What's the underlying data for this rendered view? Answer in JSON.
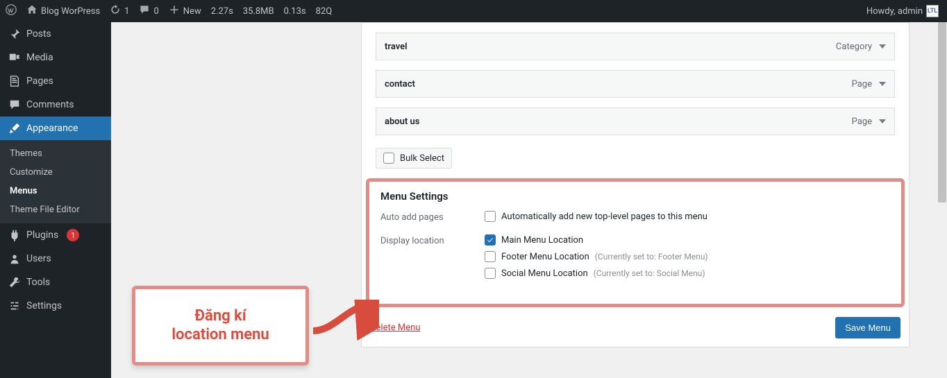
{
  "adminbar": {
    "site_title": "Blog WorPress",
    "updates": "1",
    "comments": "0",
    "new_label": "New",
    "stats": [
      "2.27s",
      "35.8MB",
      "0.13s",
      "82Q"
    ],
    "howdy": "Howdy, admin",
    "user_badge": "LTL"
  },
  "sidebar": {
    "items": [
      {
        "icon": "pin",
        "label": "Posts"
      },
      {
        "icon": "media",
        "label": "Media"
      },
      {
        "icon": "page",
        "label": "Pages"
      },
      {
        "icon": "comments",
        "label": "Comments"
      }
    ],
    "appearance_label": "Appearance",
    "appearance_sub": [
      {
        "label": "Themes"
      },
      {
        "label": "Customize"
      },
      {
        "label": "Menus",
        "current": true
      },
      {
        "label": "Theme File Editor"
      }
    ],
    "lower": [
      {
        "icon": "plugin",
        "label": "Plugins",
        "badge": "1"
      },
      {
        "icon": "users",
        "label": "Users"
      },
      {
        "icon": "tools",
        "label": "Tools"
      },
      {
        "icon": "settings",
        "label": "Settings"
      }
    ]
  },
  "menu_structure": {
    "items": [
      {
        "label": "travel",
        "type": "Category"
      },
      {
        "label": "contact",
        "type": "Page"
      },
      {
        "label": "about us",
        "type": "Page"
      }
    ],
    "bulk_label": "Bulk Select"
  },
  "menu_settings": {
    "heading": "Menu Settings",
    "auto_label": "Auto add pages",
    "auto_option": "Automatically add new top-level pages to this menu",
    "display_label": "Display location",
    "locations": [
      {
        "label": "Main Menu Location",
        "checked": true,
        "hint": ""
      },
      {
        "label": "Footer Menu Location",
        "checked": false,
        "hint": "(Currently set to: Footer Menu)"
      },
      {
        "label": "Social Menu Location",
        "checked": false,
        "hint": "(Currently set to: Social Menu)"
      }
    ]
  },
  "actions": {
    "delete": "Delete Menu",
    "save": "Save Menu"
  },
  "annotation": {
    "line1": "Đăng kí",
    "line2": "location menu"
  }
}
